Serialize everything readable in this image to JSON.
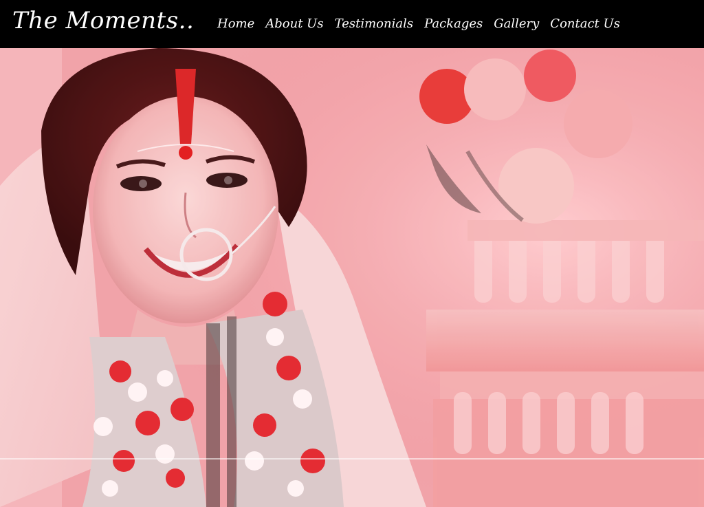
{
  "site": {
    "logo": "The Moments.."
  },
  "nav": {
    "items": [
      {
        "label": "Home"
      },
      {
        "label": "About Us"
      },
      {
        "label": "Testimonials"
      },
      {
        "label": "Packages"
      },
      {
        "label": "Gallery"
      },
      {
        "label": "Contact Us"
      }
    ]
  },
  "hero": {
    "image": "bridal-portrait-photo"
  },
  "colors": {
    "header_bg": "#000000",
    "nav_text": "#ffffff",
    "photo_tint": "#f0a8ae"
  }
}
